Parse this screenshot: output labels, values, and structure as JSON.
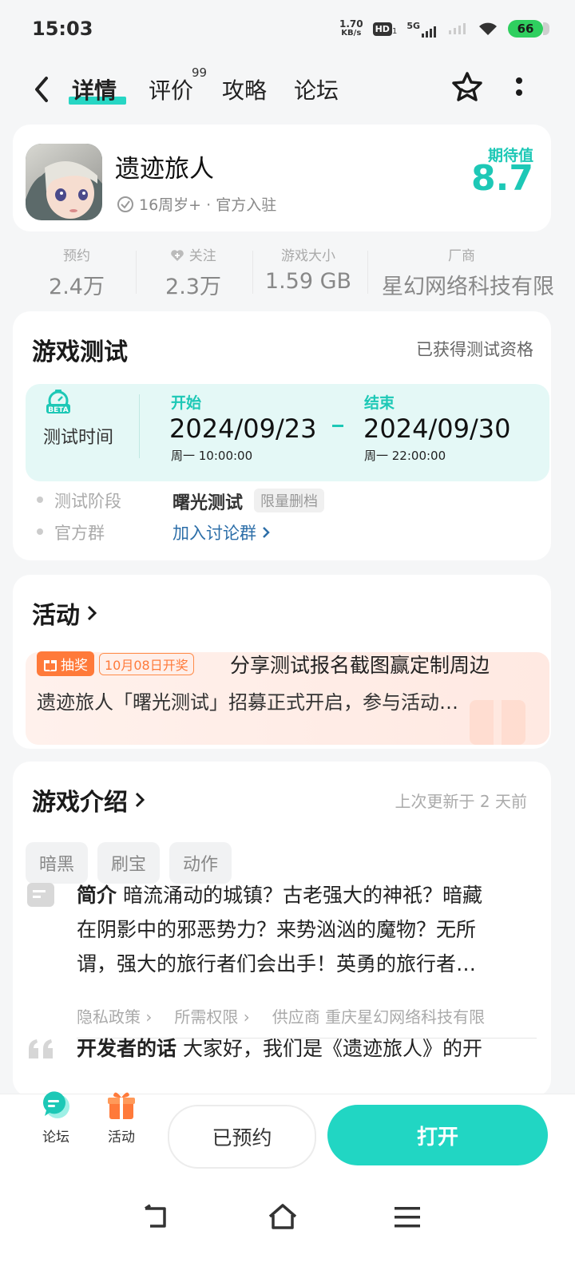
{
  "status": {
    "time": "15:03",
    "net_speed": "1.70",
    "net_unit": "KB/s",
    "hd": "HD",
    "hd_sub": "1",
    "signal_label": "5G",
    "battery": "66"
  },
  "nav": {
    "tabs": [
      {
        "label": "详情"
      },
      {
        "label": "评价"
      },
      {
        "label": "攻略"
      },
      {
        "label": "论坛"
      }
    ],
    "review_count": "99"
  },
  "game": {
    "title": "遗迹旅人",
    "meta": "16周岁+ · 官方入驻",
    "expect_label": "期待值",
    "expect_value": "8.7"
  },
  "stats": [
    {
      "label": "预约",
      "value": "2.4万"
    },
    {
      "label": "关注",
      "value": "2.3万"
    },
    {
      "label": "游戏大小",
      "value": "1.59 GB"
    },
    {
      "label": "厂商",
      "value": "星幻网络科技有限"
    }
  ],
  "test": {
    "title": "游戏测试",
    "status": "已获得测试资格",
    "time_label": "测试时间",
    "beta_badge": "BETA",
    "start_label": "开始",
    "start_date": "2024/09/23",
    "start_time": "周一  10:00:00",
    "end_label": "结束",
    "end_date": "2024/09/30",
    "end_time": "周一  22:00:00",
    "phase_label": "测试阶段",
    "phase_value": "曙光测试",
    "phase_tag": "限量删档",
    "group_label": "官方群",
    "group_link": "加入讨论群"
  },
  "activity": {
    "title": "活动",
    "tag": "抽奖",
    "date_tag": "10月08日开奖",
    "headline": "分享测试报名截图赢定制周边",
    "desc": "遗迹旅人「曙光测试」招募正式开启，参与活动…"
  },
  "intro": {
    "title": "游戏介绍",
    "updated": "上次更新于 2 天前",
    "tags": [
      "暗黑",
      "刷宝",
      "动作"
    ],
    "summary_label": "简介",
    "summary_line1": "暗流涌动的城镇？古老强大的神祇？暗藏",
    "summary_line2": "在阴影中的邪恶势力？来势汹汹的魔物？无所",
    "summary_line3": "谓，强大的旅行者们会出手！英勇的旅行者…",
    "privacy": "隐私政策",
    "permissions": "所需权限",
    "supplier": "供应商 重庆星幻网络科技有限",
    "dev_label": "开发者的话",
    "dev_text": "大家好，我们是《遗迹旅人》的开"
  },
  "bottom": {
    "forum": "论坛",
    "activity": "活动",
    "reserved": "已预约",
    "open": "打开"
  },
  "colors": {
    "accent": "#1dc8b6",
    "button": "#21d6c3",
    "orange": "#ff7a3a"
  }
}
